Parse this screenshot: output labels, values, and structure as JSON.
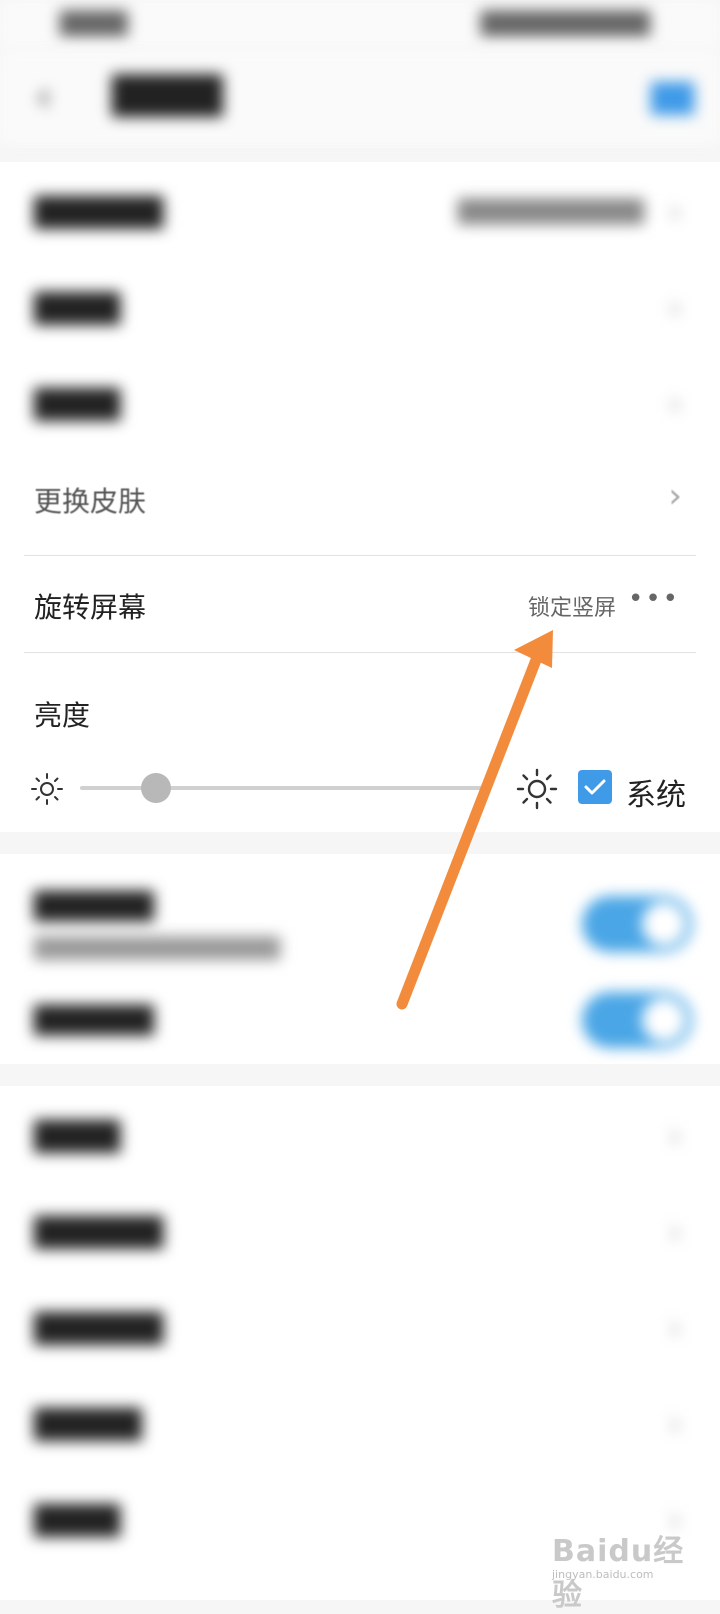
{
  "status_bar": {
    "left_text": "████",
    "right_text": "██████████"
  },
  "header": {
    "back_icon": "chevron-left-icon",
    "title": "████",
    "action_label": "██"
  },
  "blurred_rows_top": [
    {
      "label": "██████",
      "value": "███████████"
    },
    {
      "label": "████"
    },
    {
      "label": "████"
    }
  ],
  "skin_row": {
    "label": "更换皮肤",
    "chevron_icon": "chevron-right-icon"
  },
  "rotate_row": {
    "label": "旋转屏幕",
    "value": "锁定竖屏",
    "more_icon": "more-horizontal-icon"
  },
  "brightness": {
    "label": "亮度",
    "low_icon": "sun-small-icon",
    "high_icon": "sun-large-icon",
    "level": 0.15,
    "system_checked": true,
    "system_label": "系统"
  },
  "toggle_rows": [
    {
      "label": "██████",
      "sublabel": "████████████████",
      "on": true
    },
    {
      "label": "██████",
      "on": true
    }
  ],
  "blurred_rows_bottom": [
    {
      "label": "████"
    },
    {
      "label": "██████"
    },
    {
      "label": "██████"
    },
    {
      "label": "█████"
    },
    {
      "label": "████"
    }
  ],
  "watermark": {
    "brand": "Baidu经验",
    "url": "jingyan.baidu.com"
  },
  "colors": {
    "accent": "#3f9ae8",
    "annotation_arrow": "#f28c3c"
  }
}
